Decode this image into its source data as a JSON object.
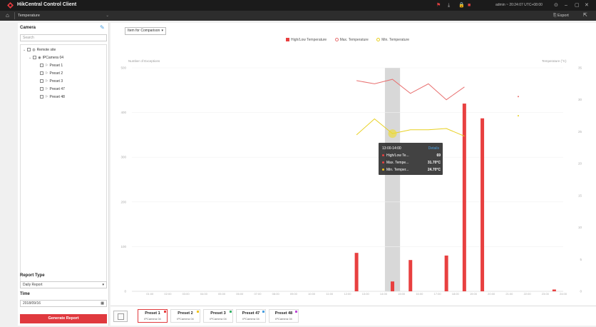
{
  "app": {
    "title": "HikCentral Control Client",
    "user": "admin ~ 20:24:07 UTC+08:00"
  },
  "tabbar": {
    "tab_label": "Temperature",
    "export_label": "Export"
  },
  "sidebar": {
    "camera_label": "Camera",
    "search_placeholder": "Search",
    "tree": [
      {
        "label": "Remote site",
        "level": 0,
        "icon": "globe-icon"
      },
      {
        "label": "IPCamera 04",
        "level": 1,
        "icon": "camera-icon"
      },
      {
        "label": "Preset 1",
        "level": 2,
        "icon": "preset-flag-icon"
      },
      {
        "label": "Preset 2",
        "level": 2,
        "icon": "preset-flag-icon"
      },
      {
        "label": "Preset 3",
        "level": 2,
        "icon": "preset-flag-icon"
      },
      {
        "label": "Preset 47",
        "level": 2,
        "icon": "preset-flag-icon"
      },
      {
        "label": "Preset 48",
        "level": 2,
        "icon": "preset-flag-icon"
      }
    ],
    "report_type_label": "Report Type",
    "report_type_value": "Daily Report",
    "time_label": "Time",
    "time_value": "2018/09/16",
    "generate_label": "Generate Report"
  },
  "main": {
    "item_compare": "Item for Comparison",
    "legend": [
      "High/Low Temperature",
      "Max. Temperature",
      "Min. Temperature"
    ],
    "left_axis_title": "Number of Exceptions",
    "right_axis_title": "Temperature (°C)"
  },
  "tooltip": {
    "header": "13:00-14:00",
    "detail": "Details",
    "rows": [
      {
        "label": "High/Low Te...",
        "value": "69",
        "color": "#e84040"
      },
      {
        "label": "Max. Tempe...",
        "value": "31.70°C",
        "color": "#e84040"
      },
      {
        "label": "Min. Temper...",
        "value": "24.70°C",
        "color": "#f0c419"
      }
    ]
  },
  "presets": [
    {
      "name": "Preset 1",
      "camera": "IPCamera 04",
      "tag_color": "#e84040",
      "active": true
    },
    {
      "name": "Preset 2",
      "camera": "IPCamera 04",
      "tag_color": "#f0c419",
      "active": false
    },
    {
      "name": "Preset 3",
      "camera": "IPCamera 04",
      "tag_color": "#3ab26a",
      "active": false
    },
    {
      "name": "Preset 47",
      "camera": "IPCamera 04",
      "tag_color": "#4a9fe0",
      "active": false
    },
    {
      "name": "Preset 48",
      "camera": "IPCamera 04",
      "tag_color": "#c04ad8",
      "active": false
    }
  ],
  "chart_data": {
    "type": "bar",
    "categories": [
      "00:00",
      "01:00",
      "02:00",
      "03:00",
      "04:00",
      "05:00",
      "06:00",
      "07:00",
      "08:00",
      "09:00",
      "10:00",
      "11:00",
      "12:00",
      "13:00",
      "14:00",
      "15:00",
      "16:00",
      "17:00",
      "18:00",
      "19:00",
      "20:00",
      "21:00",
      "22:00",
      "23:00"
    ],
    "x_tick_labels": [
      "01:00",
      "02:00",
      "03:00",
      "04:00",
      "05:00",
      "06:00",
      "07:00",
      "08:00",
      "09:00",
      "10:00",
      "11:00",
      "12:00",
      "13:00",
      "14:00",
      "15:00",
      "16:00",
      "17:00",
      "18:00",
      "19:00",
      "20:00",
      "21:00",
      "22:00",
      "23:00",
      "24:00"
    ],
    "bar_series": {
      "name": "High/Low Temperature",
      "values": [
        0,
        0,
        0,
        0,
        0,
        0,
        0,
        0,
        0,
        0,
        0,
        0,
        86,
        0,
        22,
        70,
        0,
        80,
        420,
        387,
        0,
        0,
        0,
        4
      ]
    },
    "line_series": [
      {
        "name": "Max. Temperature",
        "color": "#e87070",
        "values": [
          null,
          null,
          null,
          null,
          null,
          null,
          null,
          null,
          null,
          null,
          null,
          null,
          null,
          null,
          null,
          null,
          null,
          null,
          null,
          null,
          null,
          null,
          null,
          null
        ],
        "points": [
          [
            12,
            33
          ],
          [
            13,
            32.5
          ],
          [
            14,
            33.2
          ],
          [
            15,
            31
          ],
          [
            16,
            32.5
          ],
          [
            17,
            30
          ],
          [
            18,
            32
          ]
        ]
      },
      {
        "name": "Min. Temperature",
        "color": "#e8d020",
        "points": [
          [
            12,
            24.5
          ],
          [
            13,
            27
          ],
          [
            14,
            24.7
          ],
          [
            15,
            25.3
          ],
          [
            16,
            25.3
          ],
          [
            17,
            25.5
          ],
          [
            18,
            24.3
          ]
        ]
      }
    ],
    "isolated_points": [
      {
        "series": "Max. Temperature",
        "x": 21,
        "y": 30.5
      },
      {
        "series": "Min. Temperature",
        "x": 21,
        "y": 27.5
      }
    ],
    "highlight_category": 14,
    "ylim_left": [
      0,
      500
    ],
    "ylim_right": [
      0,
      35
    ],
    "left_ticks": [
      0,
      100,
      200,
      300,
      400,
      500
    ],
    "right_ticks": [
      0,
      5,
      10,
      15,
      20,
      25,
      30,
      35
    ],
    "xlabel": "",
    "ylabel": "Number of Exceptions",
    "y2label": "Temperature (°C)",
    "colors": {
      "bar": "#e84040",
      "max": "#e87070",
      "min": "#e8d020",
      "highlight": "#d8d8d8"
    },
    "legend_position": "top"
  }
}
